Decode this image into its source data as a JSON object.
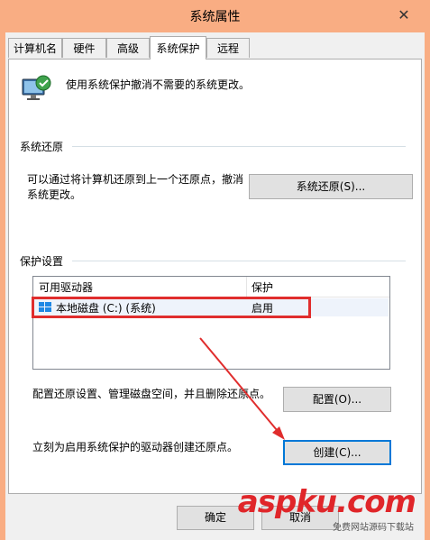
{
  "window": {
    "title": "系统属性",
    "close_glyph": "✕"
  },
  "tabs": [
    {
      "label": "计算机名"
    },
    {
      "label": "硬件"
    },
    {
      "label": "高级"
    },
    {
      "label": "系统保护"
    },
    {
      "label": "远程"
    }
  ],
  "active_tab": "系统保护",
  "intro": {
    "text": "使用系统保护撤消不需要的系统更改。",
    "icon": "system-protection-icon"
  },
  "restore": {
    "heading": "系统还原",
    "description_line1": "可以通过将计算机还原到上一个还原点，撤消",
    "description_line2": "系统更改。",
    "button_label": "系统还原(S)..."
  },
  "protection": {
    "heading": "保护设置",
    "columns": {
      "drive": "可用驱动器",
      "protection": "保护"
    },
    "rows": [
      {
        "drive": "本地磁盘 (C:) (系统)",
        "protection": "启用",
        "icon": "windows-drive-icon"
      }
    ],
    "configure_text": "配置还原设置、管理磁盘空间，并且删除还原点。",
    "configure_button": "配置(O)...",
    "create_text": "立刻为启用系统保护的驱动器创建还原点。",
    "create_button": "创建(C)..."
  },
  "footer": {
    "ok": "确定",
    "cancel": "取消"
  },
  "watermark": {
    "text": "aspku.com",
    "subtitle": "免费网站源码下载站"
  },
  "colors": {
    "titlebar": "#f9ad83",
    "highlight": "#e02d2d",
    "arrow": "#e02d2d"
  }
}
